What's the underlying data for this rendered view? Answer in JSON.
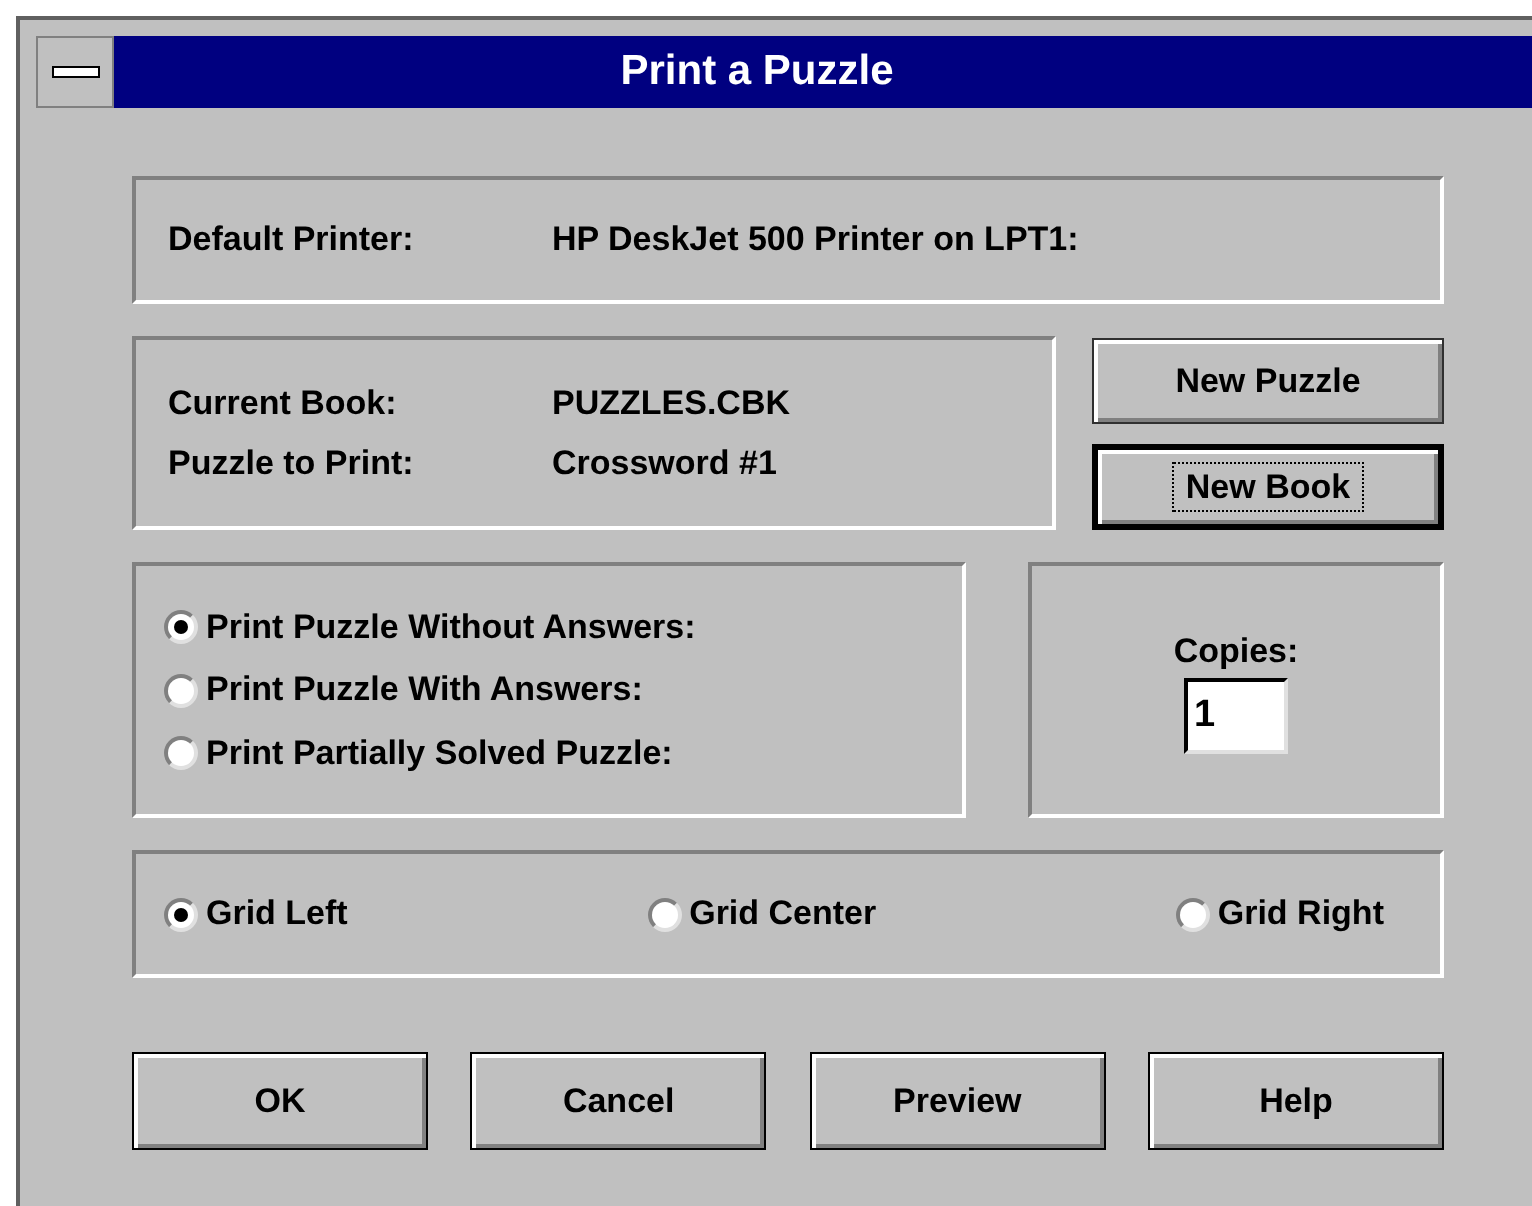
{
  "window": {
    "title": "Print a Puzzle"
  },
  "printer": {
    "label": "Default Printer:",
    "value": "HP DeskJet 500 Printer on LPT1:"
  },
  "book": [
    {
      "label": "Current Book:",
      "value": "PUZZLES.CBK"
    },
    {
      "label": "Puzzle to Print:",
      "value": "Crossword #1"
    }
  ],
  "side_buttons": [
    {
      "label": "New Puzzle",
      "focused": false
    },
    {
      "label": "New Book",
      "focused": true
    }
  ],
  "print_options": [
    {
      "label": "Print Puzzle Without Answers:",
      "selected": true
    },
    {
      "label": "Print Puzzle With Answers:",
      "selected": false
    },
    {
      "label": "Print Partially Solved Puzzle:",
      "selected": false
    }
  ],
  "copies": {
    "label": "Copies:",
    "value": "1"
  },
  "grid_options": [
    {
      "label": "Grid Left",
      "selected": true
    },
    {
      "label": "Grid Center",
      "selected": false
    },
    {
      "label": "Grid Right",
      "selected": false
    }
  ],
  "buttons": [
    "OK",
    "Cancel",
    "Preview",
    "Help"
  ]
}
